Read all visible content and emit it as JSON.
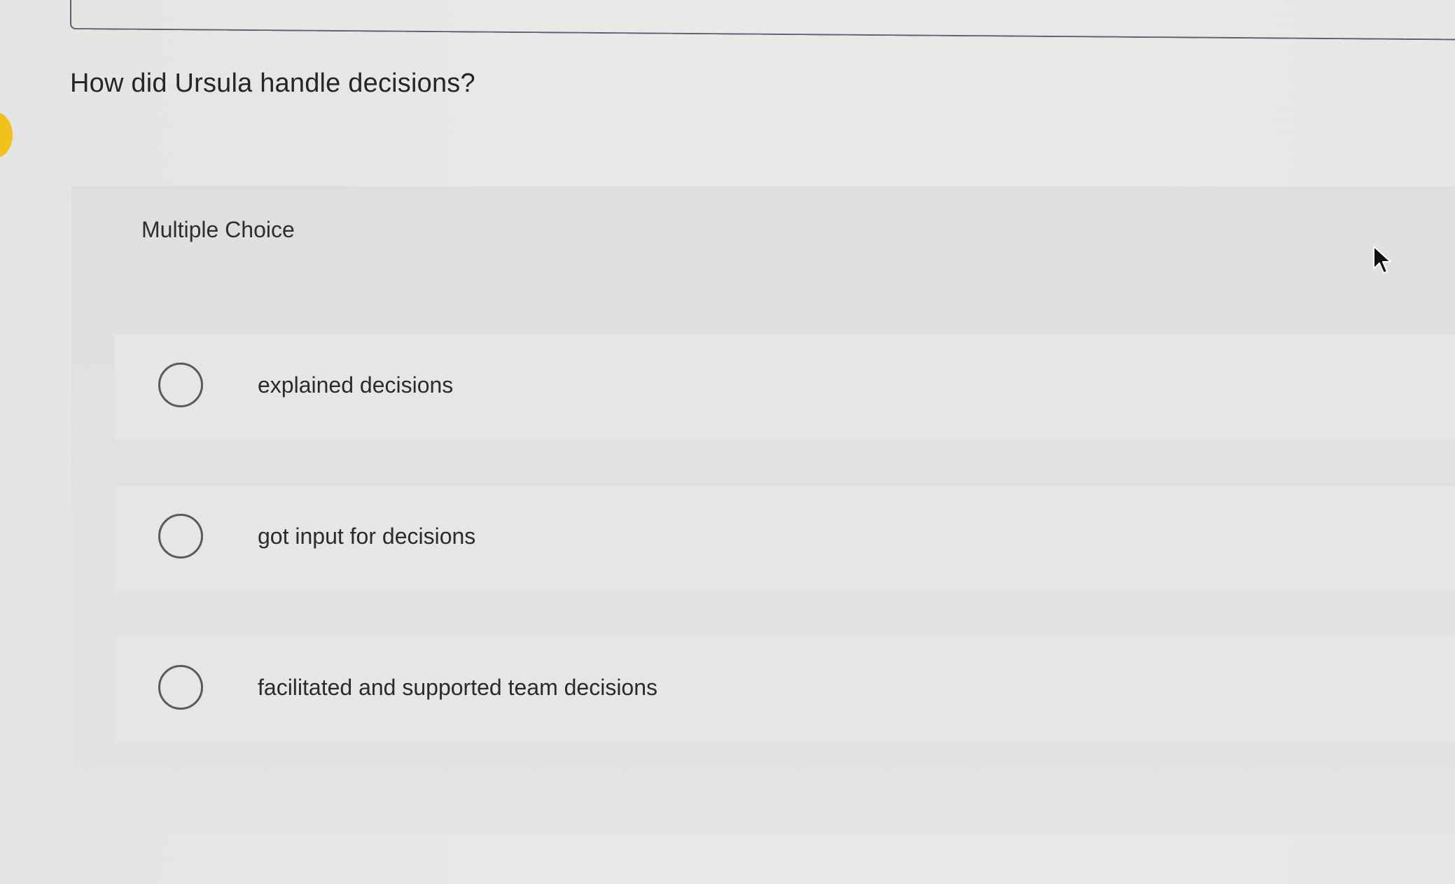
{
  "question": {
    "text": "How did Ursula handle decisions?"
  },
  "panel": {
    "label": "Multiple Choice"
  },
  "options": [
    {
      "label": "explained decisions",
      "selected": false
    },
    {
      "label": "got input for decisions",
      "selected": false
    },
    {
      "label": "facilitated and supported team decisions",
      "selected": false
    }
  ],
  "colors": {
    "accent_marker": "#f1c21b",
    "radio_border": "#5b5b5b",
    "top_box_border": "#56607a"
  },
  "icons": {
    "cursor": "mouse-pointer-icon",
    "radio": "radio-empty-icon"
  }
}
